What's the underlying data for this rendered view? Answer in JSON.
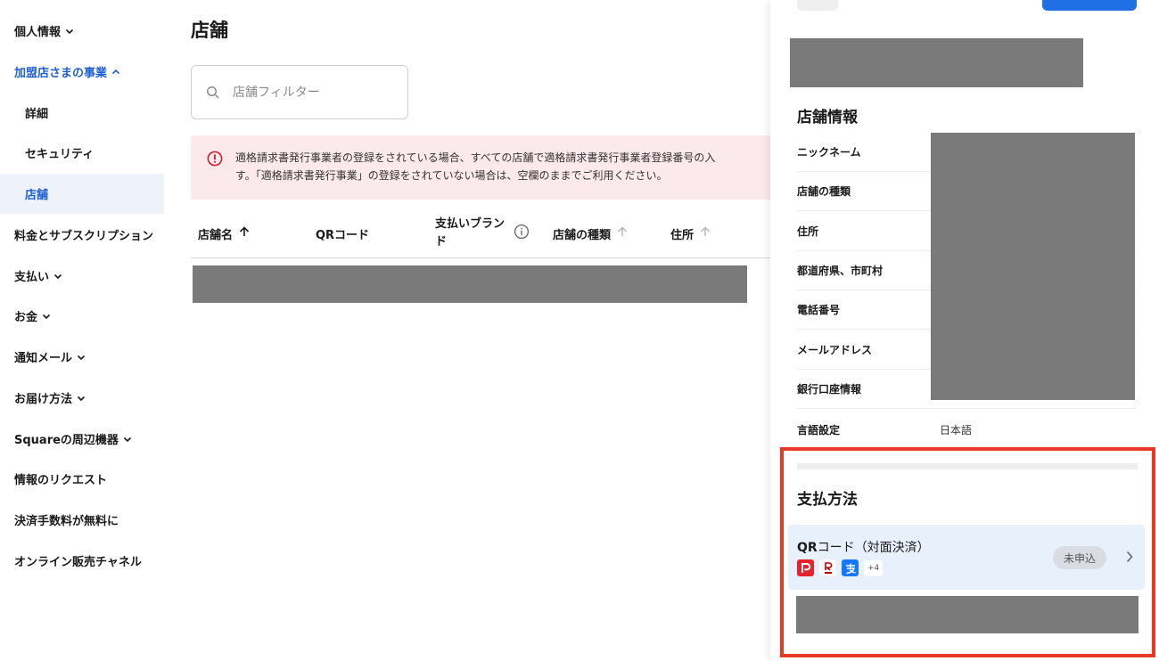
{
  "sidebar": {
    "items": [
      {
        "label": "個人情報",
        "chevron": "down"
      },
      {
        "label": "加盟店さまの事業",
        "chevron": "up",
        "state": "expanded"
      },
      {
        "label": "詳細",
        "sub": true
      },
      {
        "label": "セキュリティ",
        "sub": true
      },
      {
        "label": "店舗",
        "sub": true,
        "state": "active"
      },
      {
        "label": "料金とサブスクリプション"
      },
      {
        "label": "支払い",
        "chevron": "down"
      },
      {
        "label": "お金",
        "chevron": "down"
      },
      {
        "label": "通知メール",
        "chevron": "down"
      },
      {
        "label": "お届け方法",
        "chevron": "down"
      },
      {
        "label": "Squareの周辺機器",
        "chevron": "down"
      },
      {
        "label": "情報のリクエスト"
      },
      {
        "label": "決済手数料が無料に"
      },
      {
        "label": "オンライン販売チャネル"
      }
    ]
  },
  "main": {
    "title": "店舗",
    "filter_placeholder": "店舗フィルター",
    "alert": {
      "line1": "適格請求書発行事業者の登録をされている場合、すべての店舗で適格請求書発行事業者登録番号の入",
      "line2": "す。「適格請求書発行事業」の登録をされていない場合は、空欄のままでご利用ください。"
    },
    "table": {
      "columns": {
        "name": "店舗名",
        "qr": "QRコード",
        "brand": "支払いブランド",
        "type": "店舗の種類",
        "address": "住所"
      }
    }
  },
  "panel": {
    "store_info_title": "店舗情報",
    "rows": {
      "nickname": "ニックネーム",
      "store_type": "店舗の種類",
      "address": "住所",
      "prefecture": "都道府県、市町村",
      "phone": "電話番号",
      "email": "メールアドレス",
      "bank": "銀行口座情報",
      "language": "言語設定"
    },
    "language_value": "日本語",
    "payment_title": "支払方法",
    "payment_card": {
      "title_bold": "QR",
      "title_rest": "コード（対面決済）",
      "more_count": "+4",
      "status": "未申込"
    }
  },
  "colors": {
    "accent": "#1f5fd1",
    "active_bg": "#eef3fb",
    "alert_bg": "#fbe9eb",
    "alert_icon": "#d0222e",
    "highlight": "#e63a25",
    "redaction": "#7a7a7a",
    "card_bg": "#e8f0fb"
  }
}
